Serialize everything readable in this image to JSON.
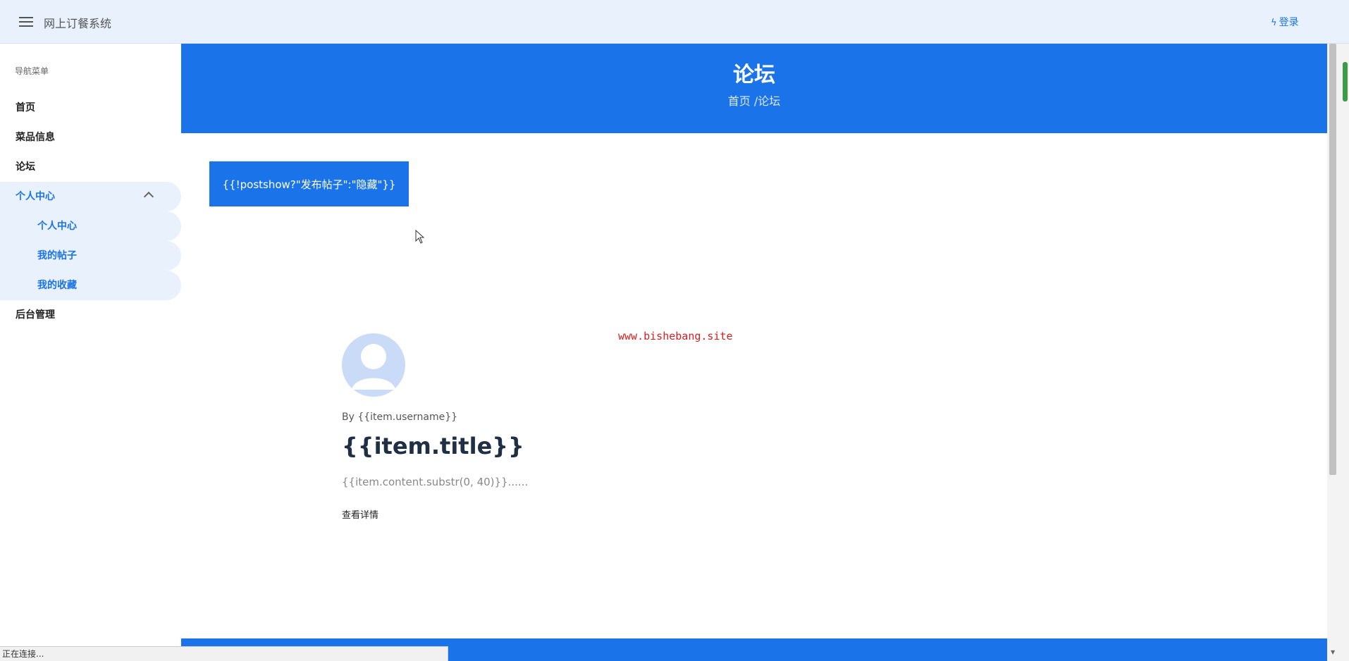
{
  "app": {
    "title": "网上订餐系统",
    "login_label": "登录",
    "bolt_glyph": "ϟ"
  },
  "sidebar": {
    "header": "导航菜单",
    "items": [
      {
        "label": "首页"
      },
      {
        "label": "菜品信息"
      },
      {
        "label": "论坛"
      },
      {
        "label": "个人中心",
        "expanded": true
      },
      {
        "label": "后台管理"
      }
    ],
    "sub_items": [
      {
        "label": "个人中心"
      },
      {
        "label": "我的帖子"
      },
      {
        "label": "我的收藏"
      }
    ]
  },
  "hero": {
    "title": "论坛",
    "breadcrumb": "首页 /论坛"
  },
  "actions": {
    "post_button": "{{!postshow?\"发布帖子\":\"隐藏\"}}"
  },
  "watermark": "www.bishebang.site",
  "post": {
    "by": "By {{item.username}}",
    "title": "{{item.title}}",
    "excerpt": "{{item.content.substr(0, 40)}}......",
    "more": "查看详情"
  },
  "status": {
    "text": "正在连接..."
  },
  "colors": {
    "primary": "#1a73e8",
    "topbar": "#e8f1fc",
    "watermark": "#d42020"
  }
}
